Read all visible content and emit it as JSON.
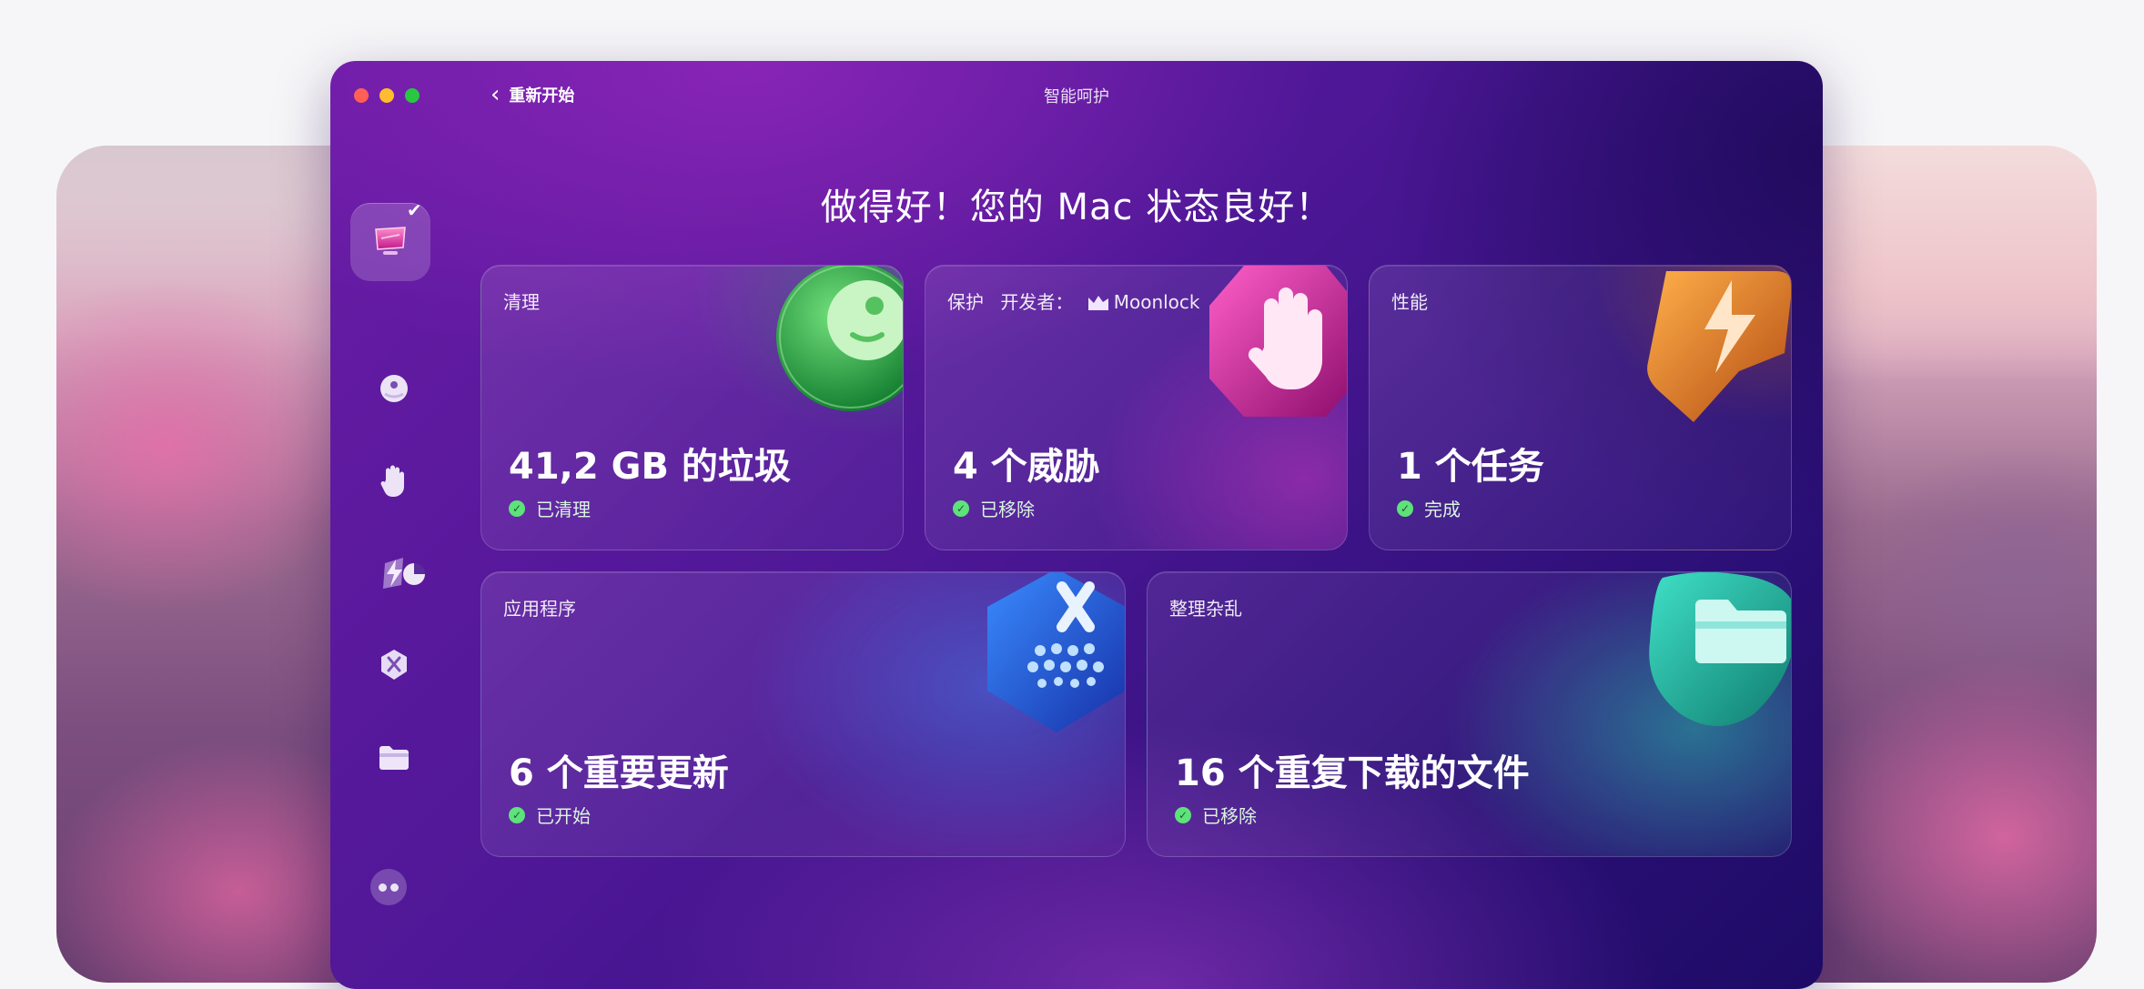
{
  "window": {
    "title": "智能呵护",
    "back_label": "重新开始"
  },
  "headline": "做得好！您的 Mac 状态良好！",
  "sidebar": {
    "items": [
      {
        "name": "smart-care",
        "icon": "monitor-sparkle-icon",
        "active": true
      },
      {
        "name": "cleanup",
        "icon": "disc-icon"
      },
      {
        "name": "protection",
        "icon": "hand-icon"
      },
      {
        "name": "performance",
        "icon": "bolt-icon"
      },
      {
        "name": "applications",
        "icon": "apps-icon"
      },
      {
        "name": "clutter",
        "icon": "folder-icon"
      }
    ]
  },
  "cards": {
    "cleanup": {
      "label": "清理",
      "value": "41,2 GB 的垃圾",
      "status": "已清理"
    },
    "protection": {
      "label": "保护",
      "developer_prefix": "开发者：",
      "developer": "Moonlock",
      "value": "4 个威胁",
      "status": "已移除"
    },
    "performance": {
      "label": "性能",
      "value": "1 个任务",
      "status": "完成"
    },
    "applications": {
      "label": "应用程序",
      "value": "6 个重要更新",
      "status": "已开始"
    },
    "clutter": {
      "label": "整理杂乱",
      "value": "16 个重复下载的文件",
      "status": "已移除"
    }
  },
  "colors": {
    "status_ok": "#5ee27a",
    "window_accent": "#6a1ca6"
  }
}
